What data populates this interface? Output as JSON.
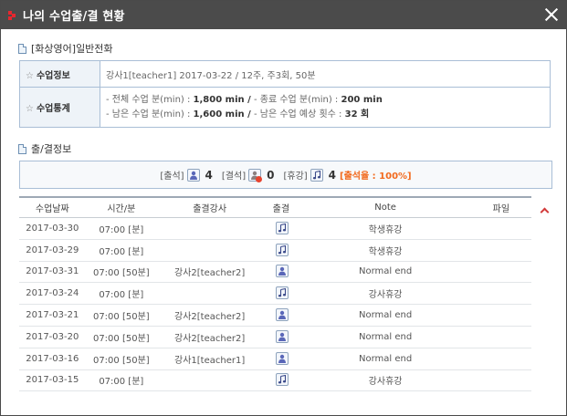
{
  "window": {
    "title": "나의 수업출/결 현황"
  },
  "course": {
    "section_title": "[화상영어]일반전화",
    "info_label": "수업정보",
    "info_value": "강사1[teacher1] 2017-03-22 / 12주, 주3회, 50분",
    "stats_label": "수업통계",
    "stats": {
      "total_label": "- 전체 수업 분(min) :",
      "total_value": "1,800 min /",
      "end_label": "- 종료 수업 분(min) :",
      "end_value": "200 min",
      "remaining_label": "- 남은 수업 분(min) :",
      "remaining_value": "1,600 min /",
      "expected_label": "- 남은 수업 예상 횟수 :",
      "expected_value": "32 회"
    }
  },
  "attendance": {
    "section_title": "출/결정보",
    "present_label": "[출석]",
    "present_count": "4",
    "absent_label": "[결석]",
    "absent_count": "0",
    "holiday_label": "[휴강]",
    "holiday_count": "4",
    "rate": "[출석율 : 100%]"
  },
  "table": {
    "columns": [
      "수업날짜",
      "시간/분",
      "출결강사",
      "출결",
      "Note",
      "파일"
    ],
    "rows": [
      {
        "date": "2017-03-30",
        "time": "07:00 [분]",
        "teacher": "",
        "status_icon": "music-note-icon",
        "note": "학생휴강",
        "file": ""
      },
      {
        "date": "2017-03-29",
        "time": "07:00 [분]",
        "teacher": "",
        "status_icon": "music-note-icon",
        "note": "학생휴강",
        "file": ""
      },
      {
        "date": "2017-03-31",
        "time": "07:00 [50분]",
        "teacher": "강사2[teacher2]",
        "status_icon": "person-icon",
        "note": "Normal end",
        "file": ""
      },
      {
        "date": "2017-03-24",
        "time": "07:00 [분]",
        "teacher": "",
        "status_icon": "music-note-icon",
        "note": "강사휴강",
        "file": ""
      },
      {
        "date": "2017-03-21",
        "time": "07:00 [50분]",
        "teacher": "강사2[teacher2]",
        "status_icon": "person-icon",
        "note": "Normal end",
        "file": ""
      },
      {
        "date": "2017-03-20",
        "time": "07:00 [50분]",
        "teacher": "강사2[teacher2]",
        "status_icon": "person-icon",
        "note": "Normal end",
        "file": ""
      },
      {
        "date": "2017-03-16",
        "time": "07:00 [50분]",
        "teacher": "강사1[teacher1]",
        "status_icon": "person-icon",
        "note": "Normal end",
        "file": ""
      },
      {
        "date": "2017-03-15",
        "time": "07:00 [분]",
        "teacher": "",
        "status_icon": "music-note-icon",
        "note": "강사휴강",
        "file": ""
      }
    ]
  },
  "colors": {
    "titlebar": "#4b4b4b",
    "accent_red": "#e8262e",
    "rate_orange": "#f26a1d",
    "border_blue": "#a9bed6"
  }
}
